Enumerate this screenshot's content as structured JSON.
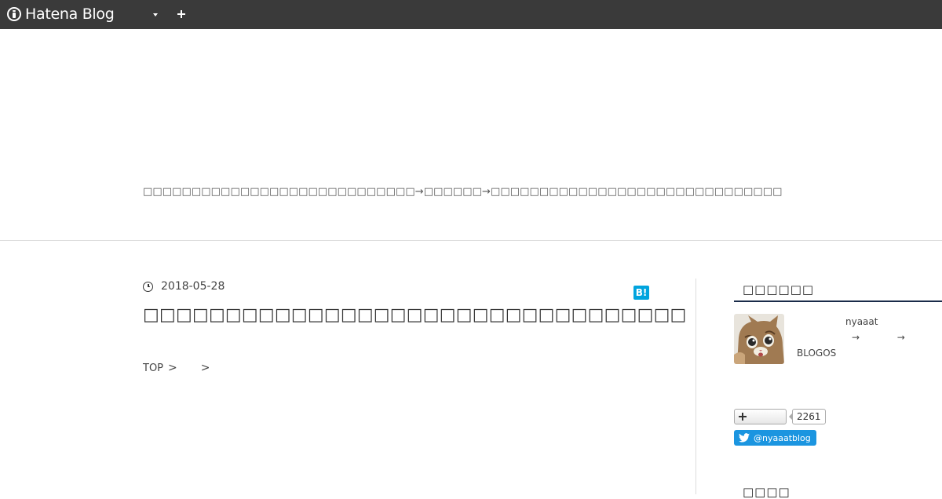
{
  "global_header": {
    "logo_text": "Hatena Blog"
  },
  "blog_header": {
    "description": "□□□□□□□□□□□□□□□□□□□□□□□□□□□□→□□□□□□→□□□□□□□□□□□□□□□□□□□□□□□□□□□□□□"
  },
  "entry": {
    "date": "2018-05-28",
    "hatebu_label": "B!",
    "title": "□□□□□□□□□□□□□□□□□□□□□□□□□□□□□□□□□",
    "breadcrumb": {
      "top": "TOP",
      "separator": ">"
    }
  },
  "sidebar": {
    "profile_title": "□□□□□□",
    "profile_name": "nyaaat",
    "profile_line2_a": "→",
    "profile_line2_b": "→",
    "profile_line3": "BLOGOS",
    "subscribe_count": "2261",
    "twitter_label": "@nyaaatblog",
    "next_section_title": "□□□□"
  },
  "colors": {
    "global_header_bg": "#3a3a3a",
    "hatebu_blue": "#00a4de",
    "twitter_blue": "#1b95e0",
    "sidebar_title_underline": "#1a2b49"
  }
}
